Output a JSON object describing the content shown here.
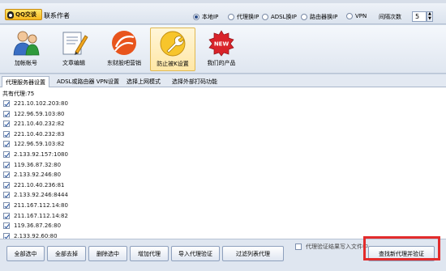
{
  "header": {
    "qq_label": "QQ交谈",
    "contact_label": "联系作者",
    "modes": [
      {
        "label": "本地IP",
        "selected": true
      },
      {
        "label": "代理换IP",
        "selected": false
      },
      {
        "label": "ADSL换IP",
        "selected": false
      },
      {
        "label": "路由器换IP",
        "selected": false
      },
      {
        "label": "VPN",
        "selected": false
      }
    ],
    "interval_label": "间隔次数",
    "interval_value": "5"
  },
  "toolbar": {
    "items": [
      {
        "label": "加帐帐号",
        "icon": "user-add-icon"
      },
      {
        "label": "文章编辑",
        "icon": "document-edit-icon"
      },
      {
        "label": "东财股吧营销",
        "icon": "swirl-logo-icon"
      },
      {
        "label": "防止被K设置",
        "icon": "wrench-icon",
        "active": true
      },
      {
        "label": "我们的产品",
        "icon": "new-badge-icon"
      }
    ]
  },
  "tabs": [
    {
      "label": "代理服务器设置",
      "active": true
    },
    {
      "label": "ADSL或路由器 VPN设置",
      "active": false
    },
    {
      "label": "选择上网模式",
      "active": false
    },
    {
      "label": "选择外部打码功能",
      "active": false
    }
  ],
  "proxy": {
    "count_label": "共有代理:75",
    "items": [
      {
        "ip": "221.10.102.203:80",
        "checked": true
      },
      {
        "ip": "122.96.59.103:80",
        "checked": true
      },
      {
        "ip": "221.10.40.232:82",
        "checked": true
      },
      {
        "ip": "221.10.40.232:83",
        "checked": true
      },
      {
        "ip": "122.96.59.103:82",
        "checked": true
      },
      {
        "ip": "2.133.92.157:1080",
        "checked": true
      },
      {
        "ip": "119.36.87.32:80",
        "checked": true
      },
      {
        "ip": "2.133.92.246:80",
        "checked": true
      },
      {
        "ip": "221.10.40.236:81",
        "checked": true
      },
      {
        "ip": "2.133.92.246:8444",
        "checked": true
      },
      {
        "ip": "211.167.112.14:80",
        "checked": true
      },
      {
        "ip": "211.167.112.14:82",
        "checked": true
      },
      {
        "ip": "119.36.87.26:80",
        "checked": true
      },
      {
        "ip": "2.133.92.60:80",
        "checked": true
      }
    ]
  },
  "actions": {
    "select_all": "全部选中",
    "deselect_all": "全部去掉",
    "delete_selected": "删除选中",
    "add_proxy": "增加代理",
    "import_verify": "导入代理验证",
    "filter_list": "过滤列表代理",
    "verify_result_label": "代理验证结果写入文件中",
    "find_proxy": "查找新代理并验证"
  },
  "colors": {
    "highlight": "#e32c2c",
    "active_tab_bg": "#ffffff",
    "chrome_bg": "#dfe6f0"
  }
}
